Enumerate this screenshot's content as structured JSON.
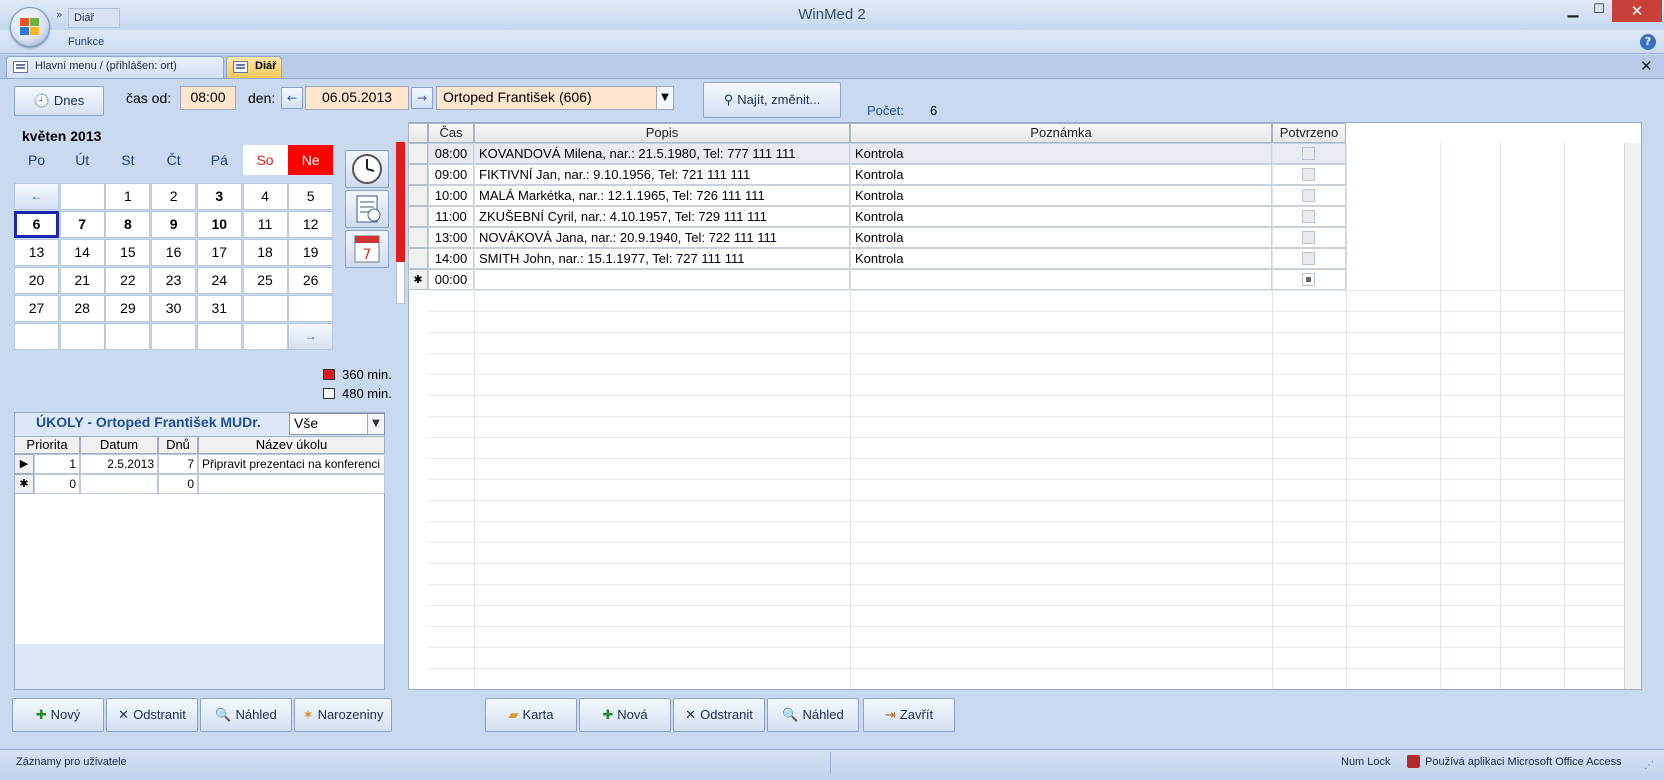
{
  "window": {
    "title": "WinMed 2",
    "quick_tab": "Diář",
    "ribbon_tab": "Funkce"
  },
  "tabs": [
    {
      "label": "Hlavní menu / (přihlášen:  ort)"
    },
    {
      "label": "Diář"
    }
  ],
  "toolbar": {
    "today_label": "Dnes",
    "time_from_label": "čas od:",
    "time_from_value": "08:00",
    "day_label": "den:",
    "day_value": "06.05.2013",
    "doctor_value": "Ortoped František (606)",
    "find_label": "Najít, změnit...",
    "count_label": "Počet:",
    "count_value": "6"
  },
  "calendar": {
    "title": "květen 2013",
    "weekdays": [
      "Po",
      "Út",
      "St",
      "Čt",
      "Pá",
      "So",
      "Ne"
    ],
    "rows": [
      [
        "←",
        "",
        "1",
        "2",
        "3",
        "4",
        "5"
      ],
      [
        "6",
        "7",
        "8",
        "9",
        "10",
        "11",
        "12"
      ],
      [
        "13",
        "14",
        "15",
        "16",
        "17",
        "18",
        "19"
      ],
      [
        "20",
        "21",
        "22",
        "23",
        "24",
        "25",
        "26"
      ],
      [
        "27",
        "28",
        "29",
        "30",
        "31",
        "",
        ""
      ],
      [
        "",
        "",
        "",
        "",
        "",
        "",
        "→"
      ]
    ]
  },
  "legend": {
    "red": "360 min.",
    "white": "480 min."
  },
  "tasks": {
    "title": "ÚKOLY - Ortoped František MUDr.",
    "filter_value": "Vše",
    "headers": [
      "Priorita",
      "Datum",
      "Dnů",
      "Název úkolu"
    ],
    "rows": [
      {
        "priority": "1",
        "date": "2.5.2013",
        "days": "7",
        "name": "Připravit prezentaci na konferenci"
      },
      {
        "priority": "0",
        "date": "",
        "days": "0",
        "name": ""
      }
    ]
  },
  "grid": {
    "headers": [
      "Čas",
      "Popis",
      "Poznámka",
      "Potvrzeno"
    ],
    "rows": [
      {
        "time": "08:00",
        "desc": "KOVANDOVÁ Milena, nar.: 21.5.1980, Tel: 777 111 111",
        "note": "Kontrola"
      },
      {
        "time": "09:00",
        "desc": "FIKTIVNÍ Jan, nar.: 9.10.1956, Tel: 721 111 111",
        "note": "Kontrola"
      },
      {
        "time": "10:00",
        "desc": "MALÁ Markétka, nar.: 12.1.1965, Tel: 726 111 111",
        "note": "Kontrola"
      },
      {
        "time": "11:00",
        "desc": "ZKUŠEBNÍ Cyril, nar.: 4.10.1957, Tel: 729 111 111",
        "note": "Kontrola"
      },
      {
        "time": "13:00",
        "desc": "NOVÁKOVÁ Jana, nar.: 20.9.1940, Tel: 722 111 111",
        "note": "Kontrola"
      },
      {
        "time": "14:00",
        "desc": "SMITH John, nar.: 15.1.1977, Tel: 727 111 111",
        "note": "Kontrola"
      }
    ],
    "new_row_time": "00:00"
  },
  "left_buttons": [
    "Nový",
    "Odstranit",
    "Náhled",
    "Narozeniny"
  ],
  "right_buttons": [
    "Karta",
    "Nová",
    "Odstranit",
    "Náhled",
    "Zavřít"
  ],
  "status": {
    "left": "Záznamy pro uživatele",
    "numlock": "Num Lock",
    "app": "Používá aplikaci Microsoft Office Access"
  }
}
